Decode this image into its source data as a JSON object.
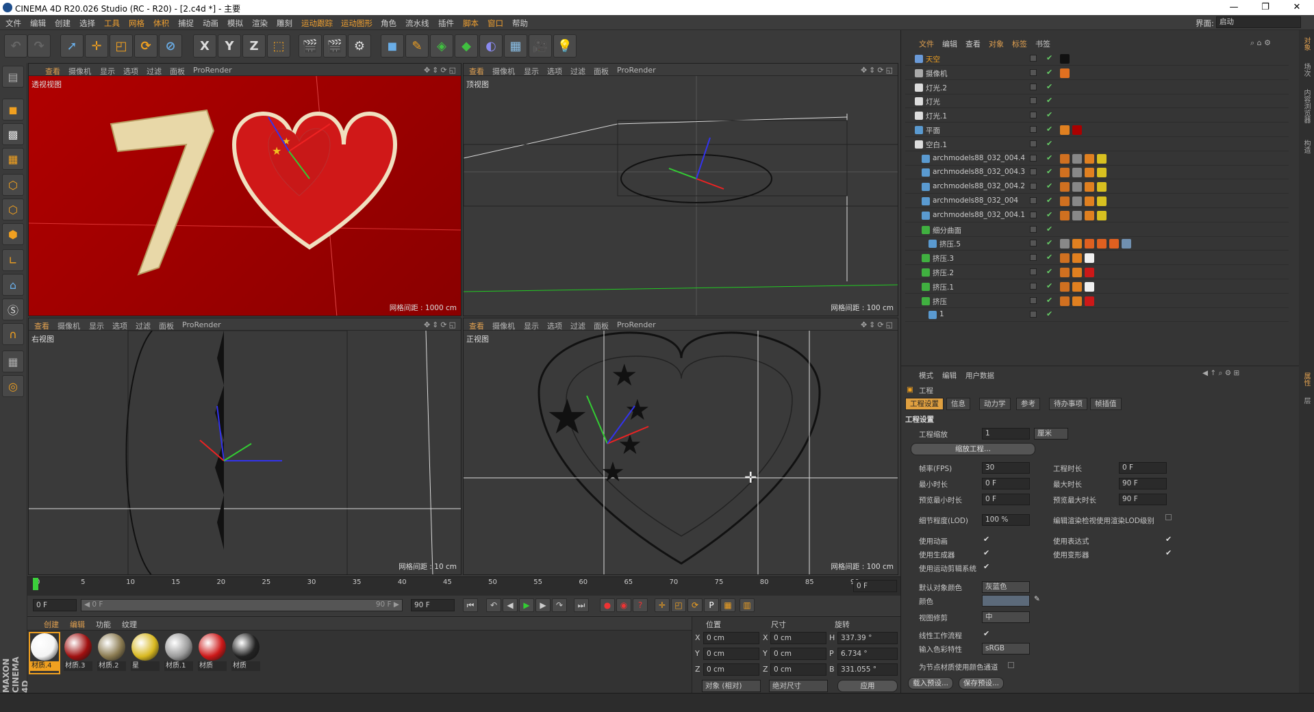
{
  "titlebar": {
    "title": "CINEMA 4D R20.026 Studio (RC - R20) - [2.c4d *] - 主要",
    "min": "—",
    "max": "❐",
    "close": "✕"
  },
  "menubar": {
    "items": [
      "文件",
      "编辑",
      "创建",
      "选择",
      "工具",
      "网格",
      "体积",
      "捕捉",
      "动画",
      "模拟",
      "渲染",
      "雕刻",
      "运动跟踪",
      "运动图形",
      "角色",
      "流水线",
      "插件",
      "脚本",
      "窗口",
      "帮助"
    ],
    "layout_label": "界面:",
    "layout_value": "启动"
  },
  "toolbar": {
    "axis_x": "X",
    "axis_y": "Y",
    "axis_z": "Z"
  },
  "viewport_menu": [
    "查看",
    "摄像机",
    "显示",
    "选项",
    "过滤",
    "面板",
    "ProRender"
  ],
  "viewports": {
    "persp": {
      "name": "透视视图",
      "grid": "网格间距 : 1000 cm"
    },
    "top": {
      "name": "顶视图",
      "grid": "网格间距 : 100 cm"
    },
    "right": {
      "name": "右视图",
      "grid": "网格间距 : 10 cm"
    },
    "front": {
      "name": "正视图",
      "grid": "网格间距 : 100 cm"
    }
  },
  "timeline": {
    "ticks": [
      "0",
      "5",
      "10",
      "15",
      "20",
      "25",
      "30",
      "35",
      "40",
      "45",
      "50",
      "55",
      "60",
      "65",
      "70",
      "75",
      "80",
      "85",
      "90"
    ],
    "end_field": "0 F",
    "start_field": "0 F",
    "slider_left": "◀ 0 F",
    "slider_right": "90 F ▶",
    "max_field": "90 F",
    "slider_fraction": 0
  },
  "material_menu": [
    "创建",
    "编辑",
    "功能",
    "纹理"
  ],
  "materials": [
    {
      "label": "材质.4",
      "color": "#f4f4f4",
      "selected": true
    },
    {
      "label": "材质.3",
      "color": "#a01010"
    },
    {
      "label": "材质.2",
      "color": "#8a7a50"
    },
    {
      "label": "星",
      "color": "#d8b820"
    },
    {
      "label": "材质.1",
      "color": "#9a9a9a"
    },
    {
      "label": "材质",
      "color": "#cc1818"
    },
    {
      "label": "材质",
      "color": "#222222"
    }
  ],
  "coords": {
    "headers": [
      "位置",
      "尺寸",
      "旋转"
    ],
    "rows": [
      {
        "axis": "X",
        "pos": "0 cm",
        "size_axis": "X",
        "size": "0 cm",
        "rot_axis": "H",
        "rot": "337.39 °"
      },
      {
        "axis": "Y",
        "pos": "0 cm",
        "size_axis": "Y",
        "size": "0 cm",
        "rot_axis": "P",
        "rot": "6.734 °"
      },
      {
        "axis": "Z",
        "pos": "0 cm",
        "size_axis": "Z",
        "size": "0 cm",
        "rot_axis": "B",
        "rot": "331.055 °"
      }
    ],
    "mode": "对象 (相对)",
    "size_mode": "绝对尺寸",
    "apply": "应用"
  },
  "objmanager": {
    "menu": [
      "文件",
      "编辑",
      "查看",
      "对象",
      "标签",
      "书签"
    ],
    "objects": [
      {
        "name": "天空",
        "indent": 0,
        "icon": "#6a9ad8",
        "hl": true,
        "tags": [
          "#111"
        ]
      },
      {
        "name": "摄像机",
        "indent": 0,
        "icon": "#aaaaaa",
        "tags": [
          "#e07020"
        ]
      },
      {
        "name": "灯光.2",
        "indent": 0,
        "icon": "#dddddd",
        "tags": []
      },
      {
        "name": "灯光",
        "indent": 0,
        "icon": "#dddddd",
        "tags": []
      },
      {
        "name": "灯光.1",
        "indent": 0,
        "icon": "#dddddd",
        "tags": []
      },
      {
        "name": "平面",
        "indent": 0,
        "icon": "#5a9ad0",
        "tags": [
          "#e08020",
          "#aa0000"
        ]
      },
      {
        "name": "空白.1",
        "indent": 0,
        "icon": "#dddddd",
        "tags": []
      },
      {
        "name": "archmodels88_032_004.4",
        "indent": 1,
        "icon": "#5a9ad0",
        "tags": [
          "#d07020",
          "#888",
          "#e08020",
          "#d8c020"
        ]
      },
      {
        "name": "archmodels88_032_004.3",
        "indent": 1,
        "icon": "#5a9ad0",
        "tags": [
          "#d07020",
          "#888",
          "#e08020",
          "#d8c020"
        ]
      },
      {
        "name": "archmodels88_032_004.2",
        "indent": 1,
        "icon": "#5a9ad0",
        "tags": [
          "#d07020",
          "#888",
          "#e08020",
          "#d8c020"
        ]
      },
      {
        "name": "archmodels88_032_004",
        "indent": 1,
        "icon": "#5a9ad0",
        "tags": [
          "#d07020",
          "#888",
          "#e08020",
          "#d8c020"
        ]
      },
      {
        "name": "archmodels88_032_004.1",
        "indent": 1,
        "icon": "#5a9ad0",
        "tags": [
          "#d07020",
          "#888",
          "#e08020",
          "#d8c020"
        ]
      },
      {
        "name": "细分曲面",
        "indent": 1,
        "icon": "#40b040",
        "tags": []
      },
      {
        "name": "挤压.5",
        "indent": 2,
        "icon": "#5a9ad0",
        "tags": [
          "#888",
          "#e08020",
          "#e06020",
          "#e06020",
          "#e06020",
          "#7090b0"
        ]
      },
      {
        "name": "挤压.3",
        "indent": 1,
        "icon": "#40b040",
        "tags": [
          "#d07020",
          "#e08020",
          "#f0f0f0"
        ]
      },
      {
        "name": "挤压.2",
        "indent": 1,
        "icon": "#40b040",
        "tags": [
          "#d07020",
          "#e08020",
          "#cc1818"
        ]
      },
      {
        "name": "挤压.1",
        "indent": 1,
        "icon": "#40b040",
        "tags": [
          "#d07020",
          "#e08020",
          "#f0f0f0"
        ]
      },
      {
        "name": "挤压",
        "indent": 1,
        "icon": "#40b040",
        "tags": [
          "#d07020",
          "#e08020",
          "#cc1818"
        ]
      },
      {
        "name": "1",
        "indent": 2,
        "icon": "#5a9ad0",
        "tags": []
      }
    ]
  },
  "attr": {
    "menu": [
      "模式",
      "编辑",
      "用户数据"
    ],
    "title": "工程",
    "tabs": [
      "工程设置",
      "信息",
      "动力学",
      "参考",
      "待办事项",
      "帧插值"
    ],
    "section": "工程设置",
    "scale_label": "工程缩放",
    "scale_value": "1",
    "scale_unit": "厘米",
    "scale_btn": "缩放工程...",
    "fps_label": "帧率(FPS)",
    "fps": "30",
    "duration_label": "工程时长",
    "duration": "0 F",
    "min_label": "最小时长",
    "min": "0 F",
    "max_label": "最大时长",
    "max": "90 F",
    "pmin_label": "预览最小时长",
    "pmin": "0 F",
    "pmax_label": "预览最大时长",
    "pmax": "90 F",
    "lod_label": "细节程度(LOD)",
    "lod": "100 %",
    "lod_render_label": "编辑渲染检视使用渲染LOD级别",
    "anim_label": "使用动画",
    "expr_label": "使用表达式",
    "gen_label": "使用生成器",
    "deform_label": "使用变形器",
    "motion_label": "使用运动剪辑系统",
    "objcolor_label": "默认对象颜色",
    "objcolor": "灰蓝色",
    "color_label": "颜色",
    "clip_label": "视图修剪",
    "clip": "中",
    "linear_label": "线性工作流程",
    "colorprofile_label": "输入色彩特性",
    "colorprofile": "sRGB",
    "nodecolor_label": "为节点材质使用颜色通道",
    "load_btn": "载入预设...",
    "save_btn": "保存预设..."
  },
  "rightstrip": [
    "对象",
    "场次",
    "内容浏览器",
    "构造"
  ],
  "attrstrip": [
    "属性",
    "层"
  ],
  "brand": "MAXON CINEMA 4D"
}
